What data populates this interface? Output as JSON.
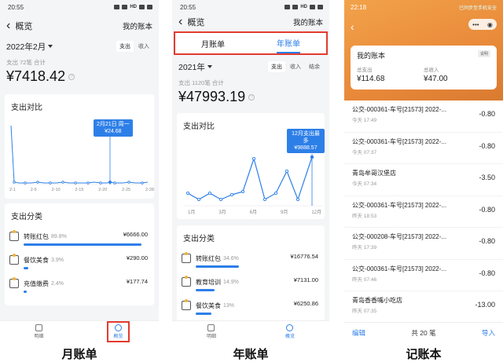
{
  "monthly": {
    "status_time": "20:55",
    "nav_title": "概览",
    "nav_right": "我的账本",
    "period": "2022年2月",
    "toggle": [
      "支出",
      "收入"
    ],
    "sum_label": "支出 72笔 合计",
    "amount": "¥7418.42",
    "trend_title": "支出对比",
    "tooltip_date": "2月21日 周一",
    "tooltip_value": "¥24.68",
    "x_ticks": [
      "2-1",
      "2-5",
      "2-10",
      "2-15",
      "2-20",
      "2-25",
      "2-28"
    ],
    "cat_title": "支出分类",
    "categories": [
      {
        "name": "转账红包",
        "pct": "89.8%",
        "value": "¥6666.00",
        "bar": 0.898
      },
      {
        "name": "餐饮美食",
        "pct": "3.9%",
        "value": "¥290.00",
        "bar": 0.039
      },
      {
        "name": "充值缴费",
        "pct": "2.4%",
        "value": "¥177.74",
        "bar": 0.024
      }
    ],
    "tabs": [
      "明细",
      "概览"
    ],
    "caption": "月账单"
  },
  "yearly": {
    "status_time": "20:55",
    "nav_title": "概览",
    "nav_right": "我的账本",
    "segments": [
      "月账单",
      "年账单"
    ],
    "period": "2021年",
    "toggle": [
      "支出",
      "收入",
      "结余"
    ],
    "sum_label": "支出 1120笔 合计",
    "amount": "¥47993.19",
    "trend_title": "支出对比",
    "tooltip_label": "12月支出最多",
    "tooltip_value": "¥9888.57",
    "x_ticks": [
      "1月",
      "3月",
      "6月",
      "9月",
      "12月"
    ],
    "cat_title": "支出分类",
    "categories": [
      {
        "name": "转账红包",
        "pct": "34.6%",
        "value": "¥16776.54",
        "bar": 0.346
      },
      {
        "name": "教育培训",
        "pct": "14.9%",
        "value": "¥7131.00",
        "bar": 0.149
      },
      {
        "name": "餐饮美食",
        "pct": "13%",
        "value": "¥6250.86",
        "bar": 0.13
      }
    ],
    "tabs": [
      "明细",
      "概览"
    ],
    "caption": "年账单"
  },
  "ledger": {
    "status_time": "22:18",
    "status_note": "已同步至手机安全",
    "book_title": "我的账本",
    "badge": "说明",
    "total_out_label": "总支出",
    "total_out": "¥114.68",
    "total_in_label": "总收入",
    "total_in": "¥47.00",
    "transactions": [
      {
        "name": "公交-000361-车号[21573] 2022-...",
        "time": "今天 17:49",
        "amount": "-0.80"
      },
      {
        "name": "公交-000361-车号[21573] 2022-...",
        "time": "今天 07:37",
        "amount": "-0.80"
      },
      {
        "name": "青岛牟哥汉堡店",
        "time": "今天 07:34",
        "amount": "-3.50"
      },
      {
        "name": "公交-000361-车号[21573] 2022-...",
        "time": "昨天 18:53",
        "amount": "-0.80"
      },
      {
        "name": "公交-000208-车号[21573] 2022-...",
        "time": "昨天 17:39",
        "amount": "-0.80"
      },
      {
        "name": "公交-000361-车号[21573] 2022-...",
        "time": "昨天 07:46",
        "amount": "-0.80"
      },
      {
        "name": "青岛香香嘴小吃店",
        "time": "昨天 07:35",
        "amount": "-13.00"
      }
    ],
    "edit_label": "编辑",
    "count_label": "共 20 笔",
    "import_label": "导入",
    "caption": "记账本"
  }
}
